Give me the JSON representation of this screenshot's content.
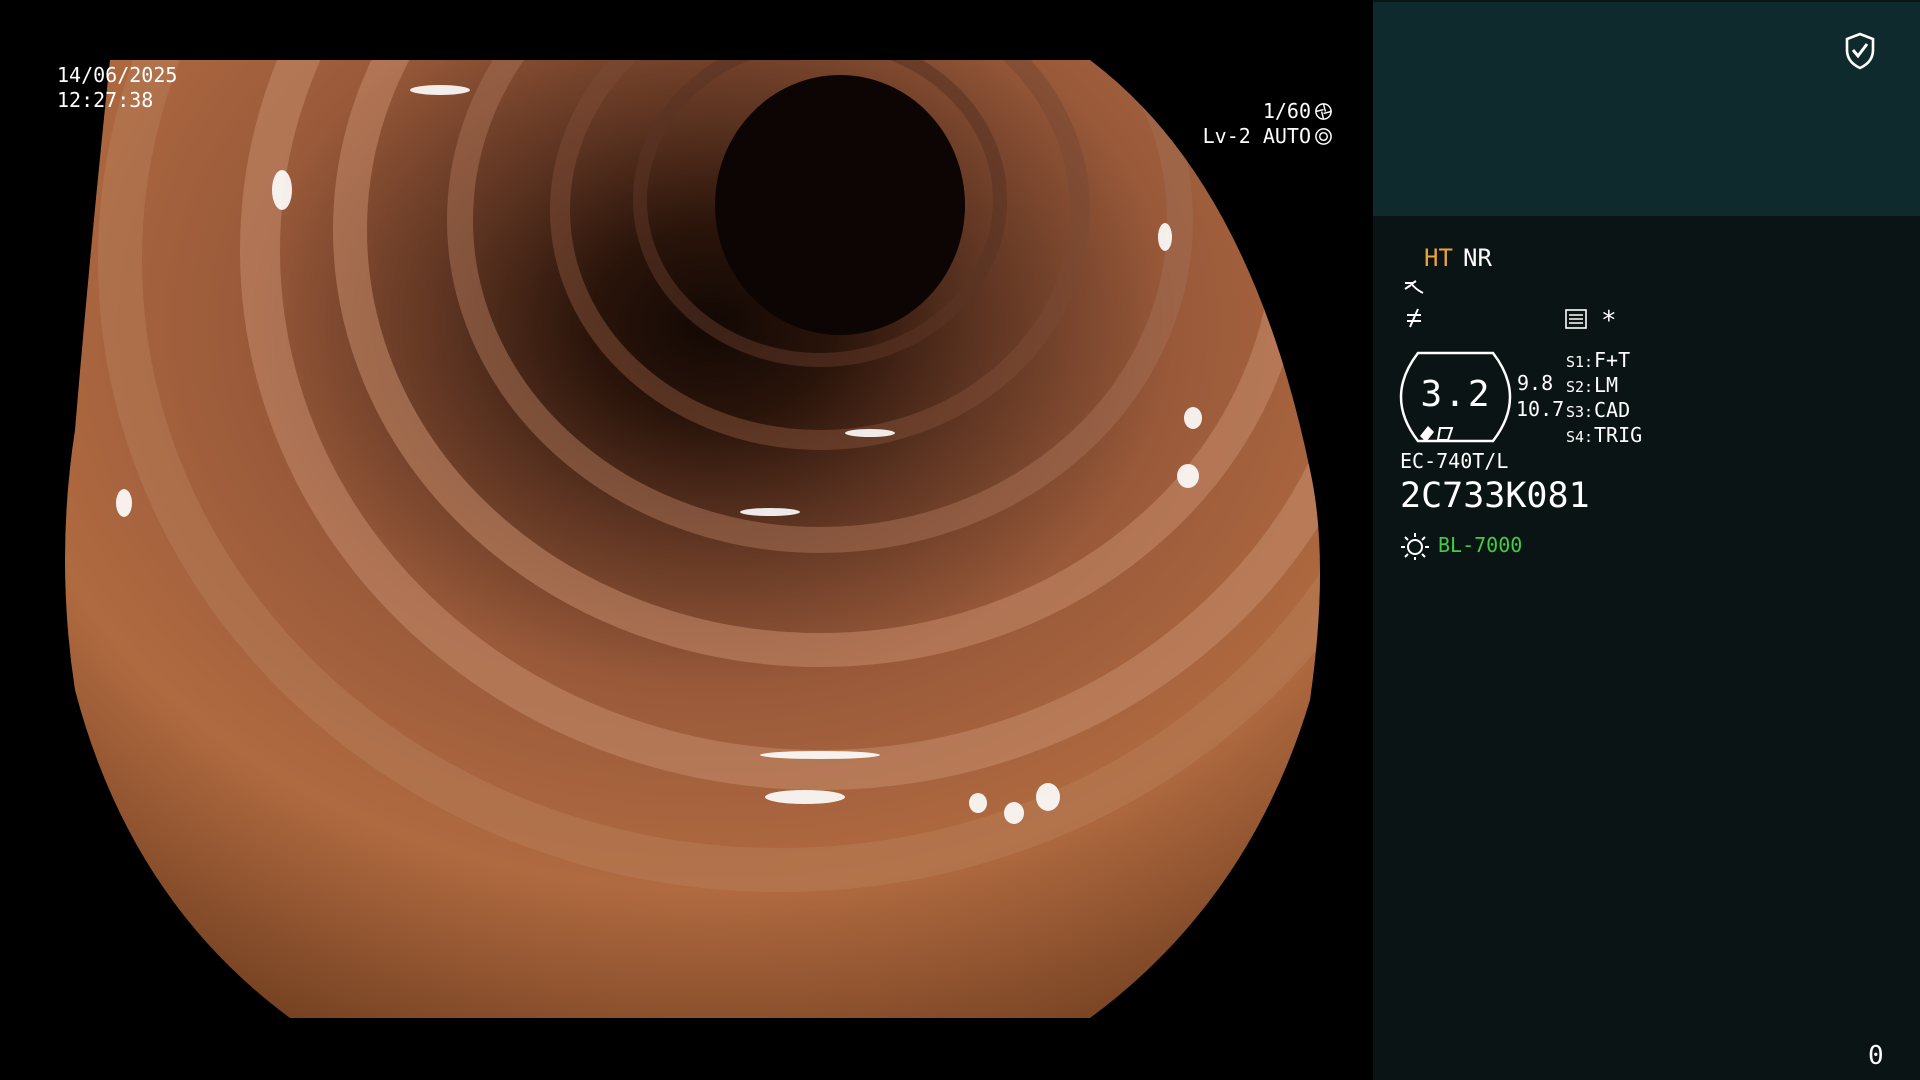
{
  "overlay": {
    "date": "14/06/2025",
    "time": "12:27:38",
    "shutter": "1/60",
    "level": "Lv-2 AUTO",
    "shutter_icon": "aperture-icon",
    "auto_icon": "iris-icon"
  },
  "panel": {
    "shield_icon": "shield-check-icon",
    "mode_ht": "HT",
    "mode_nr": "NR",
    "mode_ht_color": "#e8a33a",
    "star": "*",
    "dial_value": "3.2",
    "dial_side_1": "9.8",
    "dial_side_2": "10.7",
    "slots": [
      {
        "key": "S1:",
        "value": "F+T"
      },
      {
        "key": "S2:",
        "value": "LM"
      },
      {
        "key": "S3:",
        "value": "CAD"
      },
      {
        "key": "S4:",
        "value": "TRIG"
      }
    ],
    "scope_model": "EC-740T/L",
    "scope_serial": "2C733K081",
    "light_source": "BL-7000",
    "light_source_color": "#3fcf3f",
    "counter": "0"
  }
}
